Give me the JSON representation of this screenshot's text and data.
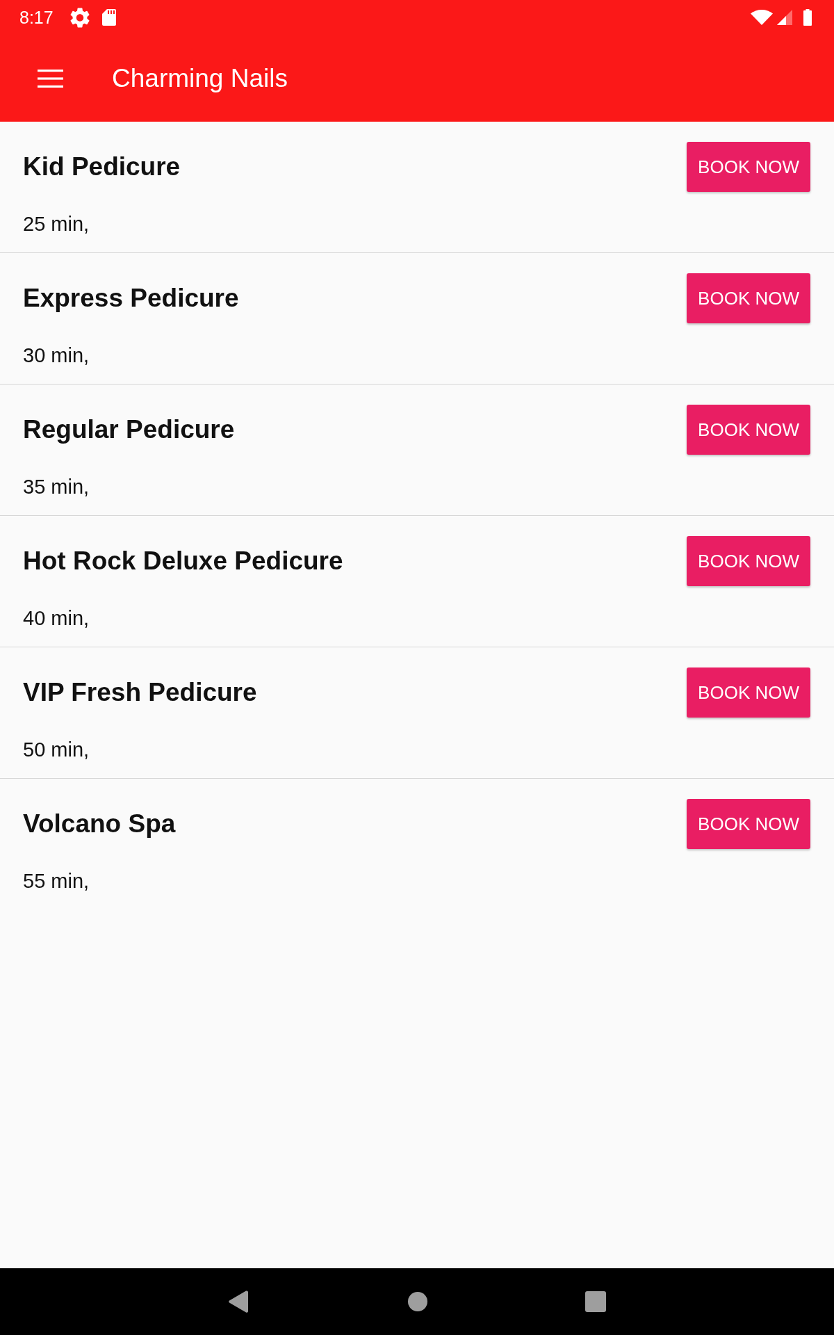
{
  "status_bar": {
    "time": "8:17"
  },
  "app_bar": {
    "title": "Charming Nails"
  },
  "services": [
    {
      "name": "Kid Pedicure",
      "duration": "25 min,",
      "button": "BOOK NOW"
    },
    {
      "name": "Express Pedicure",
      "duration": "30 min,",
      "button": "BOOK NOW"
    },
    {
      "name": "Regular Pedicure",
      "duration": "35 min,",
      "button": "BOOK NOW"
    },
    {
      "name": "Hot Rock Deluxe Pedicure",
      "duration": "40 min,",
      "button": "BOOK NOW"
    },
    {
      "name": "VIP Fresh Pedicure",
      "duration": "50 min,",
      "button": "BOOK NOW"
    },
    {
      "name": "Volcano Spa",
      "duration": "55 min,",
      "button": "BOOK NOW"
    }
  ]
}
